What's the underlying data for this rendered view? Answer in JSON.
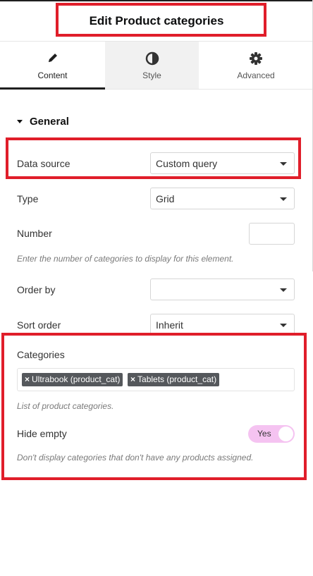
{
  "header": {
    "title": "Edit Product categories"
  },
  "tabs": [
    {
      "label": "Content",
      "icon": "pencil-icon",
      "active": true
    },
    {
      "label": "Style",
      "icon": "half-circle-icon",
      "active": false
    },
    {
      "label": "Advanced",
      "icon": "gear-icon",
      "active": false
    }
  ],
  "section": {
    "title": "General",
    "expanded": true
  },
  "fields": {
    "data_source": {
      "label": "Data source",
      "value": "Custom query"
    },
    "type": {
      "label": "Type",
      "value": "Grid"
    },
    "number": {
      "label": "Number",
      "value": "",
      "help": "Enter the number of categories to display for this element."
    },
    "order_by": {
      "label": "Order by",
      "value": ""
    },
    "sort_order": {
      "label": "Sort order",
      "value": "Inherit"
    },
    "categories": {
      "label": "Categories",
      "tags": [
        "Ultrabook (product_cat)",
        "Tablets (product_cat)"
      ],
      "help": "List of product categories."
    },
    "hide_empty": {
      "label": "Hide empty",
      "value": "Yes",
      "help": "Don't display categories that don't have any products assigned."
    }
  },
  "colors": {
    "highlight": "#e01e2a",
    "toggle_bg": "#f5c3f1",
    "tag_bg": "#55585c"
  }
}
